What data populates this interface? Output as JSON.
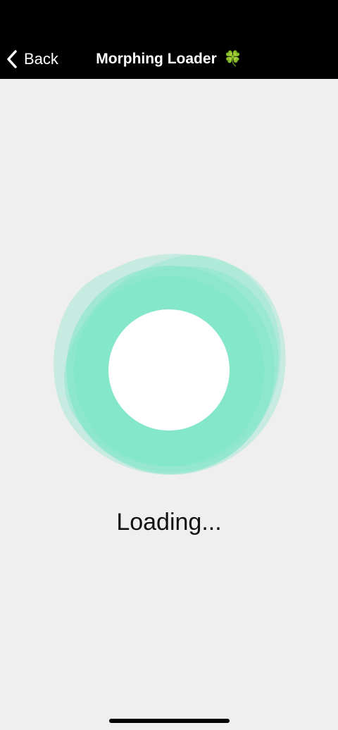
{
  "nav": {
    "back_label": "Back",
    "title": "Morphing Loader",
    "title_emoji": "🍀"
  },
  "loader": {
    "text": "Loading...",
    "accent_color": "#82e6c8",
    "center_color": "#ffffff"
  },
  "icons": {
    "back": "chevron-left-icon",
    "loader": "morphing-blob-icon"
  }
}
